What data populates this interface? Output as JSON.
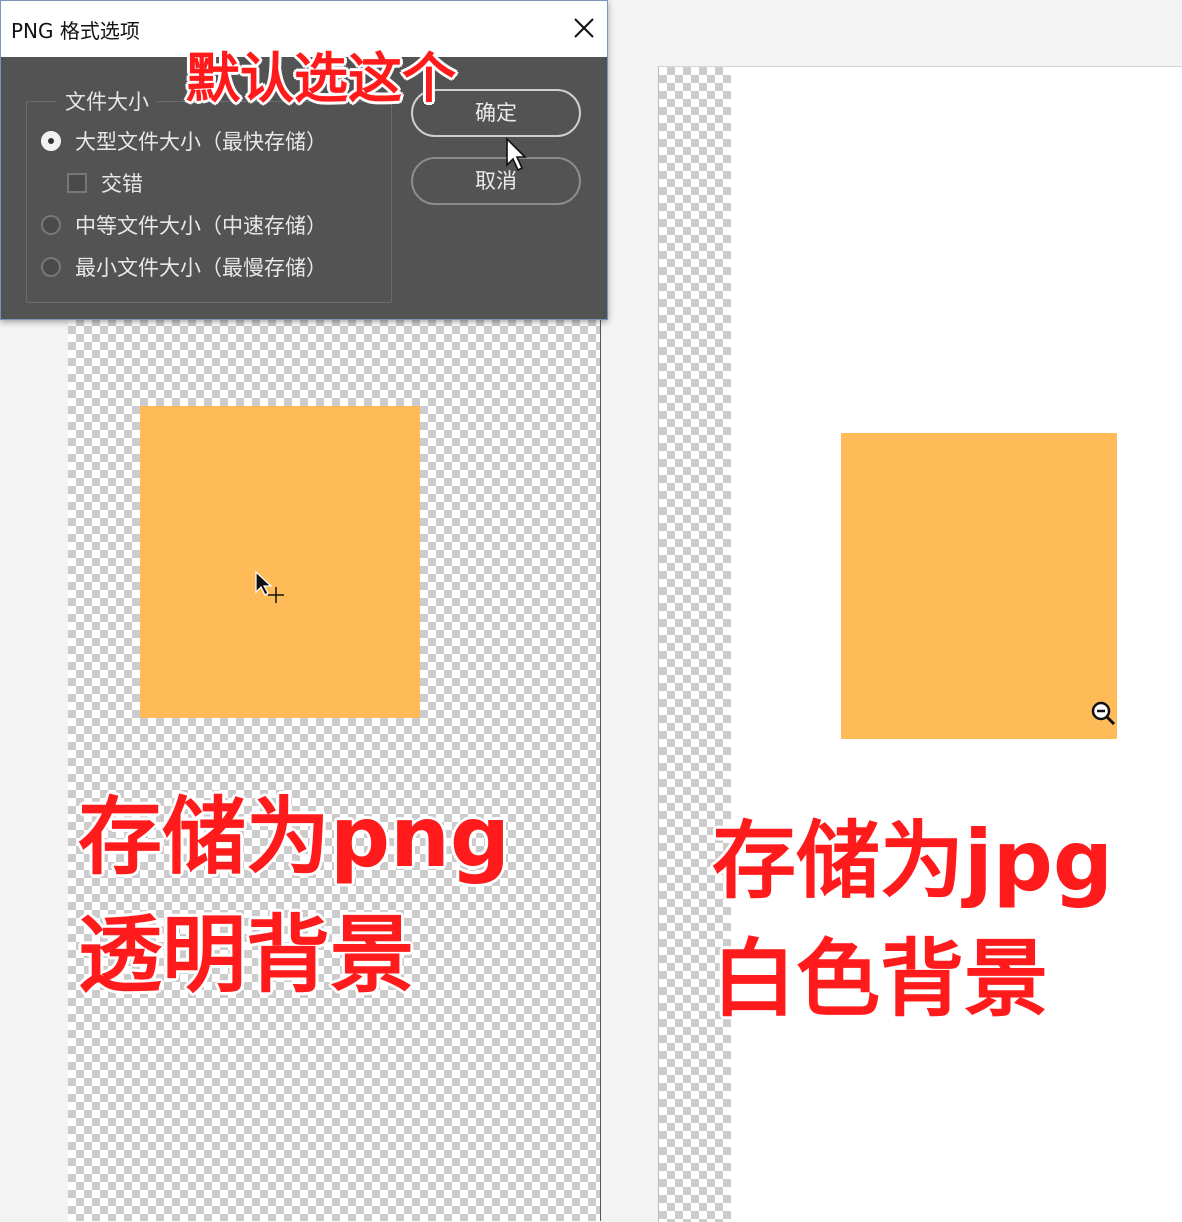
{
  "dialog": {
    "title": "PNG 格式选项",
    "group_label": "文件大小",
    "options": [
      {
        "label": "大型文件大小（最快存储）",
        "selected": true
      },
      {
        "label": "交错",
        "checked": false
      },
      {
        "label": "中等文件大小（中速存储）",
        "selected": false
      },
      {
        "label": "最小文件大小（最慢存储）",
        "selected": false
      }
    ],
    "ok_label": "确定",
    "cancel_label": "取消"
  },
  "annotations": {
    "default_choice": "默认选这个",
    "png_line1": "存储为png",
    "png_line2": "透明背景",
    "jpg_line1": "存储为jpg",
    "jpg_line2": "白色背景"
  },
  "colors": {
    "orange_fill": "#ffbb58",
    "annotation_red": "#ff1b1b",
    "dialog_bg": "#535353"
  },
  "icons": [
    "close-icon",
    "arrow-cursor-icon",
    "move-cursor-icon",
    "zoom-out-cursor-icon"
  ]
}
